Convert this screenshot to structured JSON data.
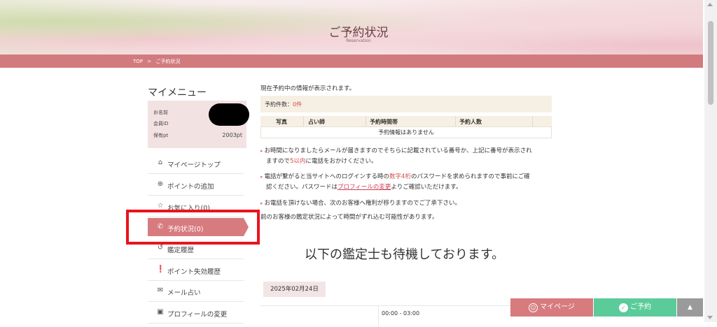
{
  "header": {
    "title": "ご予約状況",
    "subtitle": "Reservation"
  },
  "breadcrumb": {
    "home": "TOP",
    "separator": ">",
    "current": "ご予約状況"
  },
  "sidebar": {
    "title": "マイメニュー",
    "member": {
      "name_label": "お名前",
      "id_label": "会員ID",
      "points_label": "保有pt",
      "points_value": "2003pt"
    },
    "items": [
      {
        "label": "マイページトップ",
        "icon": "home-icon"
      },
      {
        "label": "ポイントの追加",
        "icon": "plus-circle-icon"
      },
      {
        "label": "お気に入り(0)",
        "icon": "star-icon"
      },
      {
        "label": "予約状況(0)",
        "icon": "phone-icon",
        "active": true
      },
      {
        "label": "鑑定履歴",
        "icon": "history-icon"
      },
      {
        "label": "ポイント失効履歴",
        "icon": "alert-icon"
      },
      {
        "label": "メール占い",
        "icon": "mail-icon"
      },
      {
        "label": "プロフィールの変更",
        "icon": "id-card-icon"
      }
    ]
  },
  "main": {
    "intro": "現在予約中の情報が表示されます。",
    "count_label": "予約件数：",
    "count_value": "0件",
    "table": {
      "headers": [
        "写真",
        "占い師",
        "予約時間帯",
        "予約人数"
      ],
      "empty_message": "予約情報はありません"
    },
    "notes": {
      "n1_a": "お時間になりましたらメールが届きますのでそちらに記載されている番号か、上記に番号が表示され",
      "n1_b1": "ますので",
      "n1_b2": "5以内",
      "n1_b3": "に電話をおかけください。",
      "n2_a1": "電話が繋がると当サイトへのログインする時の",
      "n2_a2": "数字4桁",
      "n2_a3": "のパスワードを求められますので事前にご確",
      "n2_b1": "認ください。パスワードは",
      "n2_b2": "プロフィールの変更",
      "n2_b3": "よりご確認いただけます。",
      "n3": "お電話を頂けない場合、次のお客様へ権利が移りますのでご了承下さい。",
      "n4": "前のお客様の鑑定状況によって時間がずれ込む可能性があります。"
    },
    "waiting_heading": "以下の鑑定士も待機しております。",
    "date": "2025年02月24日",
    "time_slot": "00:00 - 03:00"
  },
  "bottom_bar": {
    "mypage": "マイページ",
    "reserve": "ご予約",
    "top_icon": "arrow-up-icon"
  },
  "colors": {
    "accent": "#d77b7f",
    "reserve": "#5ccb9a",
    "highlight": "#e8141f"
  }
}
